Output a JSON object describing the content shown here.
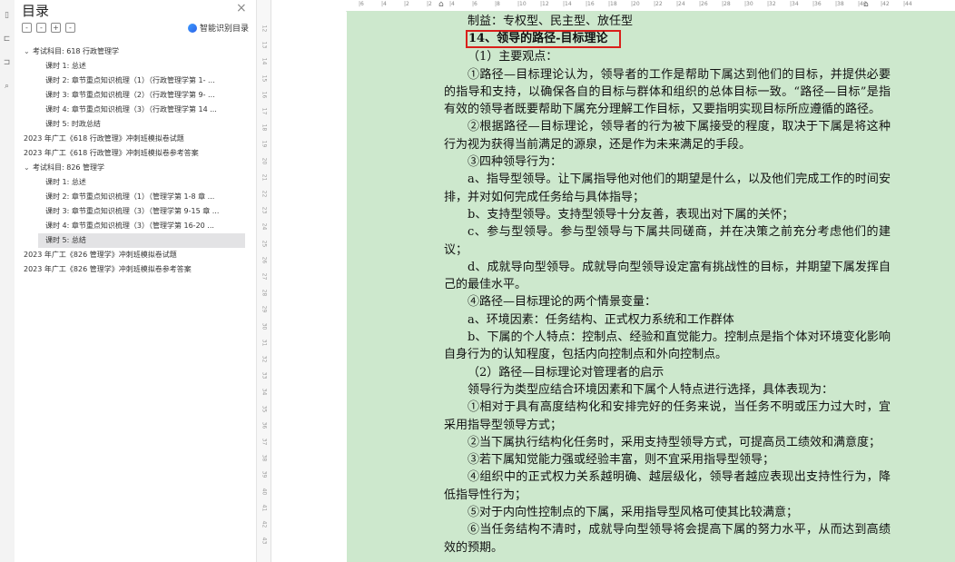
{
  "toc": {
    "title": "目录",
    "close": "×",
    "tools": [
      "-",
      "-",
      "+",
      "-"
    ],
    "smart_label": "智能识别目录",
    "items": [
      {
        "text": "考试科目: 618 行政管理学",
        "level": 0,
        "caret": "⌄"
      },
      {
        "text": "课时 1: 总述",
        "level": 1
      },
      {
        "text": "课时 2: 章节重点知识梳理（1）（行政管理学第 1- ...",
        "level": 1
      },
      {
        "text": "课时 3: 章节重点知识梳理（2）（行政管理学第 9- ...",
        "level": 1
      },
      {
        "text": "课时 4: 章节重点知识梳理（3）（行政管理学第 14 ...",
        "level": 1
      },
      {
        "text": "课时 5: 时政总结",
        "level": 1
      },
      {
        "text": "2023 年广工《618 行政管理》冲刺班模拟卷试题",
        "level": 0
      },
      {
        "text": "2023 年广工《618 行政管理》冲刺班模拟卷参考答案",
        "level": 0
      },
      {
        "text": "考试科目: 826 管理学",
        "level": 0,
        "caret": "⌄"
      },
      {
        "text": "课时 1: 总述",
        "level": 1
      },
      {
        "text": "课时 2: 章节重点知识梳理（1）（管理学第 1-8 章 ...",
        "level": 1
      },
      {
        "text": "课时 3: 章节重点知识梳理（3）（管理学第 9-15 章 ...",
        "level": 1
      },
      {
        "text": "课时 4: 章节重点知识梳理（3）（管理学第 16-20 ...",
        "level": 1
      },
      {
        "text": "课时 5: 总结",
        "level": 1,
        "selected": true
      },
      {
        "text": "2023 年广工《826 管理学》冲刺班模拟卷试题",
        "level": 0
      },
      {
        "text": "2023 年广工《826 管理学》冲刺班模拟卷参考答案",
        "level": 0
      }
    ]
  },
  "ruler": {
    "h_ticks": [
      "6",
      "4",
      "2",
      "2",
      "4",
      "6",
      "8",
      "10",
      "12",
      "14",
      "16",
      "18",
      "20",
      "22",
      "24",
      "26",
      "28",
      "30",
      "32",
      "34",
      "36",
      "38",
      "40",
      "42",
      "44"
    ],
    "v_ticks": [
      "12",
      "13",
      "14",
      "15",
      "16",
      "17",
      "18",
      "19",
      "20",
      "21",
      "22",
      "23",
      "24",
      "25",
      "26",
      "27",
      "28",
      "29",
      "30",
      "31",
      "32",
      "33",
      "34",
      "35",
      "36",
      "37",
      "38",
      "39",
      "40",
      "41",
      "42",
      "43"
    ]
  },
  "document": {
    "paragraphs": [
      {
        "text": "制益：专权型、民主型、放任型",
        "cls": "indent"
      },
      {
        "text": "14、领导的路径-目标理论",
        "cls": "heading"
      },
      {
        "text": "（1）主要观点：",
        "cls": "indent"
      },
      {
        "text": "①路径—目标理论认为，领导者的工作是帮助下属达到他们的目标，并提供必要的指导和支持，以确保各自的目标与群体和组织的总体目标一致。“路径—目标”是指有效的领导者既要帮助下属充分理解工作目标，又要指明实现目标所应遵循的路径。",
        "cls": "indent"
      },
      {
        "text": "②根据路径—目标理论，领导者的行为被下属接受的程度，取决于下属是将这种行为视为获得当前满足的源泉，还是作为未来满足的手段。",
        "cls": "indent"
      },
      {
        "text": "③四种领导行为：",
        "cls": "indent"
      },
      {
        "text": "a、指导型领导。让下属指导他对他们的期望是什么，以及他们完成工作的时间安排，并对如何完成任务给与具体指导；",
        "cls": "indent"
      },
      {
        "text": "b、支持型领导。支持型领导十分友善，表现出对下属的关怀；",
        "cls": "indent"
      },
      {
        "text": "c、参与型领导。参与型领导与下属共同磋商，并在决策之前充分考虑他们的建议；",
        "cls": "indent"
      },
      {
        "text": "d、成就导向型领导。成就导向型领导设定富有挑战性的目标，并期望下属发挥自己的最佳水平。",
        "cls": "indent"
      },
      {
        "text": "④路径—目标理论的两个情景变量：",
        "cls": "indent"
      },
      {
        "text": "a、环境因素：任务结构、正式权力系统和工作群体",
        "cls": "indent"
      },
      {
        "text": "b、下属的个人特点：控制点、经验和直觉能力。控制点是指个体对环境变化影响自身行为的认知程度，包括内向控制点和外向控制点。",
        "cls": "indent"
      },
      {
        "text": "（2）路径—目标理论对管理者的启示",
        "cls": "indent"
      },
      {
        "text": "领导行为类型应结合环境因素和下属个人特点进行选择，具体表现为：",
        "cls": "indent"
      },
      {
        "text": "①相对于具有高度结构化和安排完好的任务来说，当任务不明或压力过大时，宜采用指导型领导方式；",
        "cls": "indent"
      },
      {
        "text": "②当下属执行结构化任务时，采用支持型领导方式，可提高员工绩效和满意度；",
        "cls": "indent"
      },
      {
        "text": "③若下属知觉能力强或经验丰富，则不宜采用指导型领导；",
        "cls": "indent"
      },
      {
        "text": "④组织中的正式权力关系越明确、越层级化，领导者越应表现出支持性行为，降低指导性行为；",
        "cls": "indent"
      },
      {
        "text": "⑤对于内向性控制点的下属，采用指导型风格可使其比较满意；",
        "cls": "indent"
      },
      {
        "text": "⑥当任务结构不清时，成就导向型领导将会提高下属的努力水平，从而达到高绩效的预期。",
        "cls": "indent"
      }
    ]
  },
  "colors": {
    "doc_bg": "#cde8cd",
    "highlight_box": "#d9201b",
    "selected_item": "#e3e3e5"
  }
}
